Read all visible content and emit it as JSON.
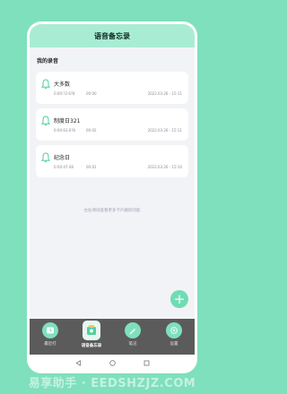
{
  "header": {
    "title": "语音备忘录"
  },
  "section_title": "我的录音",
  "recordings": [
    {
      "name": "大多数",
      "duration_raw": "0:00:?2:6?8",
      "duration": "00:00",
      "date": "2022.03.26 - 15:11"
    },
    {
      "name": "制度日321",
      "duration_raw": "0:00:63:6?8",
      "duration": "00:02",
      "date": "2022.03.26 - 15:11"
    },
    {
      "name": "纪念日",
      "duration_raw": "0:00:47:48",
      "duration": "00:01",
      "date": "2022.03.26 - 15:10"
    }
  ],
  "hint": "左右滑动查看更多卡片删除功能",
  "fab_label": "+",
  "tabs": [
    {
      "label": "最近打",
      "icon": "clock-icon",
      "active": false
    },
    {
      "label": "语音备忘录",
      "icon": "recorder-icon",
      "active": true
    },
    {
      "label": "笔记",
      "icon": "pen-icon",
      "active": false
    },
    {
      "label": "设置",
      "icon": "gear-icon",
      "active": false
    }
  ],
  "watermark": "易享助手 · EEDSHZJZ.COM",
  "colors": {
    "background": "#7fe0bd",
    "header": "#a9ecd4",
    "accent": "#6fdcb4",
    "tabbar": "#5b5b5b"
  }
}
